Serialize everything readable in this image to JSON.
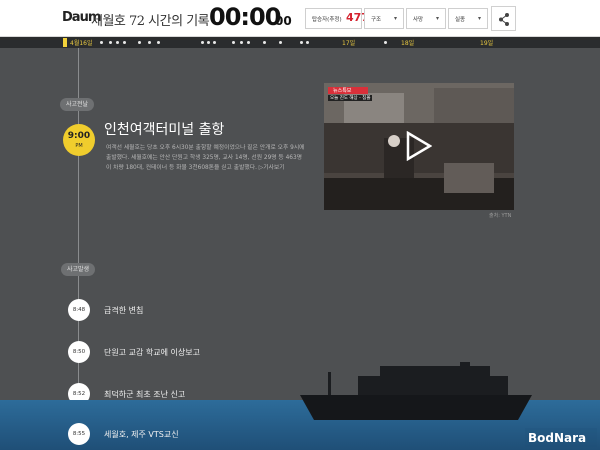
{
  "header": {
    "logo": "Daum",
    "title": "세월호 72 시간의 기록",
    "timer_main": "00:00",
    "timer_sub": "00",
    "stats": [
      {
        "label": "탑승자(추정)",
        "value": "477"
      },
      {
        "label": "구조",
        "value": ""
      },
      {
        "label": "사망",
        "value": ""
      },
      {
        "label": "실종",
        "value": ""
      }
    ],
    "caret": "▾"
  },
  "datebar": {
    "start": "4월16일",
    "days": [
      "17일",
      "18일",
      "19일"
    ]
  },
  "timeline": {
    "section1": "사고전날",
    "section2": "사고발생",
    "main_event": {
      "time": "9:00",
      "ampm": "PM",
      "title": "인천여객터미널 출항",
      "desc": "여객선 세월호는 당초 오후 6시30분 출항할 예정이었으나 짙은 안개로 오후 9시에 출발했다. 세월호에는 안산 단원고 학생 325명, 교사 14명, 선원 29명 등 463명이 차량 180대, 컨테이너 등 화물 3천608톤을 싣고 출발했다. ▷기사보기",
      "video_caption_top": "뉴스특보",
      "video_caption": "오늘 진도 해상 - 침몰",
      "photo_credit": "출처: YTN"
    },
    "events": [
      {
        "time": "8:48",
        "title": "급격한 변침"
      },
      {
        "time": "8:50",
        "title": "단원고 교감 학교에 이상보고"
      },
      {
        "time": "8:52",
        "title": "최덕하군 최초 조난 신고"
      },
      {
        "time": "8:55",
        "title": "세월호, 제주 VTS교신"
      }
    ]
  },
  "watermark": "BodNara"
}
